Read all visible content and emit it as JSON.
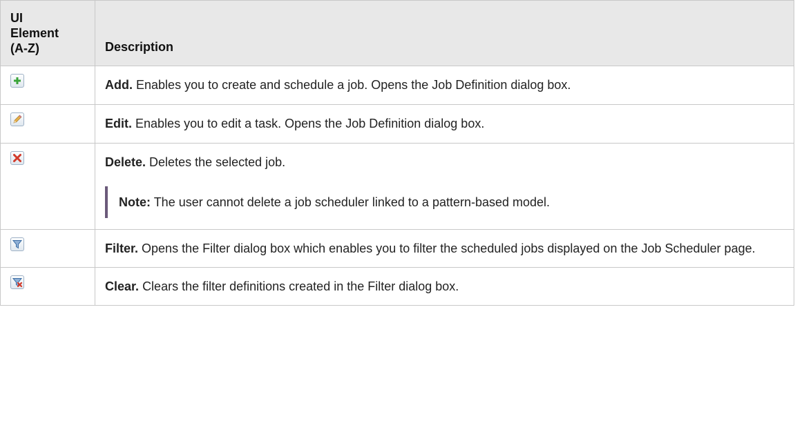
{
  "table": {
    "headers": {
      "col1_line1": "UI",
      "col1_line2": "Element",
      "col1_line3": "(A-Z)",
      "col2": "Description"
    },
    "rows": [
      {
        "icon": "add-icon",
        "term": "Add.",
        "description": "Enables you to create and schedule a job. Opens the Job Definition dialog box."
      },
      {
        "icon": "edit-pencil-icon",
        "term": "Edit.",
        "description": "Enables you to edit a task. Opens the Job Definition dialog box."
      },
      {
        "icon": "delete-x-icon",
        "term": "Delete.",
        "description": "Deletes the selected job.",
        "note": {
          "label": "Note:",
          "text": "The user cannot delete a job scheduler linked to a pattern-based model."
        }
      },
      {
        "icon": "filter-funnel-icon",
        "term": "Filter.",
        "description": "Opens the Filter dialog box which enables you to filter the scheduled jobs displayed on the Job Scheduler page."
      },
      {
        "icon": "clear-filter-icon",
        "term": "Clear.",
        "description": "Clears the filter definitions created in the Filter dialog box."
      }
    ]
  },
  "colors": {
    "header_bg": "#e8e8e8",
    "border": "#c8c8c8",
    "note_bar": "#6b5a7a",
    "add_green": "#3aa43a",
    "delete_red": "#d23a2a"
  }
}
